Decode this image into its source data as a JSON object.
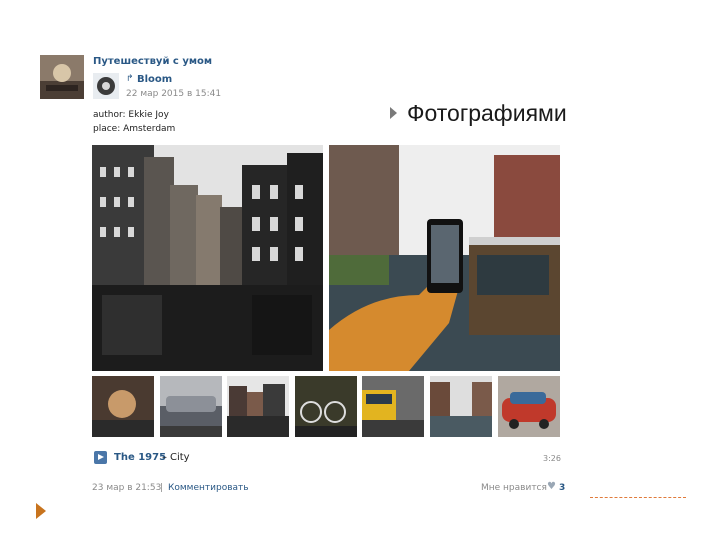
{
  "post": {
    "group_title": "Путешествуй с умом",
    "repost_name": "Bloom",
    "repost_date": "22 мар 2015 в 15:41",
    "author_line": "author: Ekkie Joy",
    "place_line": "place: Amsterdam"
  },
  "slide": {
    "title": "Фотографиями"
  },
  "audio": {
    "artist": "The 1975",
    "separator": "–",
    "track": "City",
    "duration": "3:26"
  },
  "footer": {
    "date": "23 мар в 21:53",
    "separator": "|",
    "comment_label": "Комментировать",
    "like_label": "Мне нравится",
    "like_count": "3"
  },
  "icons": {
    "repost": "repost-icon",
    "play": "play-icon",
    "heart": "heart-icon",
    "bullet": "triangle-bullet-icon",
    "nav": "next-arrow-icon"
  },
  "colors": {
    "link": "#2a5885",
    "muted": "#8a8a8a",
    "accent": "#c8741e"
  }
}
